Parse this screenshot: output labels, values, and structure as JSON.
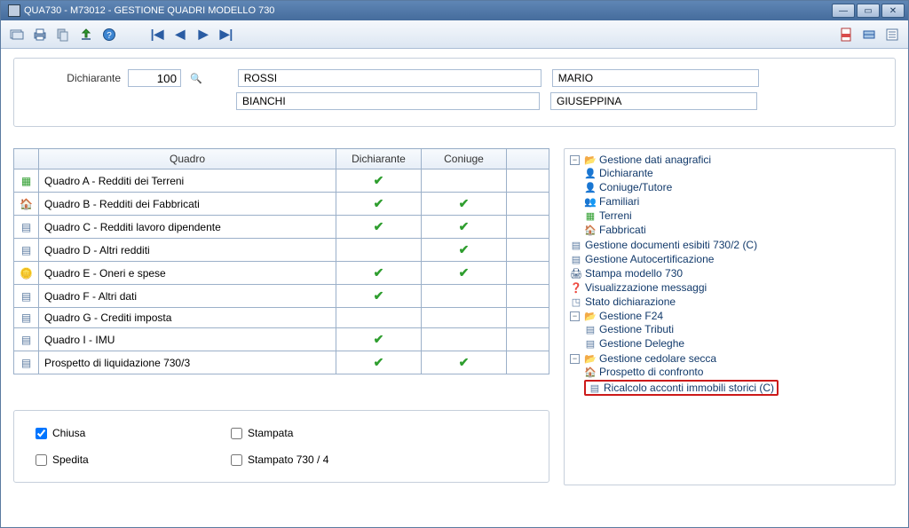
{
  "window": {
    "title": "QUA730  - M73012 -  GESTIONE QUADRI MODELLO 730"
  },
  "header": {
    "label": "Dichiarante",
    "code": "100",
    "surname1": "ROSSI",
    "first1": "MARIO",
    "surname2": "BIANCHI",
    "first2": "GIUSEPPINA"
  },
  "table": {
    "col_icon": "",
    "col_quadro": "Quadro",
    "col_dichiarante": "Dichiarante",
    "col_coniuge": "Coniuge",
    "rows": [
      {
        "icon": "terreni",
        "label": "Quadro A - Redditi dei Terreni",
        "d": true,
        "c": false
      },
      {
        "icon": "fabbricati",
        "label": "Quadro B - Redditi dei Fabbricati",
        "d": true,
        "c": true
      },
      {
        "icon": "doc",
        "label": "Quadro C - Redditi lavoro dipendente",
        "d": true,
        "c": true
      },
      {
        "icon": "doc",
        "label": "Quadro D - Altri redditi",
        "d": false,
        "c": true
      },
      {
        "icon": "oneri",
        "label": "Quadro E - Oneri e spese",
        "d": true,
        "c": true
      },
      {
        "icon": "doc",
        "label": "Quadro F - Altri dati",
        "d": true,
        "c": false
      },
      {
        "icon": "doc",
        "label": "Quadro G - Crediti imposta",
        "d": false,
        "c": false
      },
      {
        "icon": "doc",
        "label": "Quadro I - IMU",
        "d": true,
        "c": false
      },
      {
        "icon": "doc",
        "label": "Prospetto di liquidazione 730/3",
        "d": true,
        "c": true
      }
    ]
  },
  "status": {
    "chiusa": "Chiusa",
    "stampata": "Stampata",
    "spedita": "Spedita",
    "stampato730_4": "Stampato 730 / 4",
    "chiusa_checked": true,
    "stampata_checked": false,
    "spedita_checked": false,
    "stampato730_4_checked": false
  },
  "tree": {
    "n_anagrafici": "Gestione dati anagrafici",
    "n_dichiarante": "Dichiarante",
    "n_coniuge": "Coniuge/Tutore",
    "n_familiari": "Familiari",
    "n_terreni": "Terreni",
    "n_fabbricati": "Fabbricati",
    "n_doc_esibiti": "Gestione documenti esibiti 730/2 (C)",
    "n_autocert": "Gestione Autocertificazione",
    "n_stampa": "Stampa modello 730",
    "n_messaggi": "Visualizzazione messaggi",
    "n_stato": "Stato dichiarazione",
    "n_f24": "Gestione F24",
    "n_tributi": "Gestione Tributi",
    "n_deleghe": "Gestione Deleghe",
    "n_cedolare": "Gestione cedolare secca",
    "n_prospetto": "Prospetto di confronto",
    "n_ricalcolo": "Ricalcolo acconti immobili storici (C)"
  }
}
